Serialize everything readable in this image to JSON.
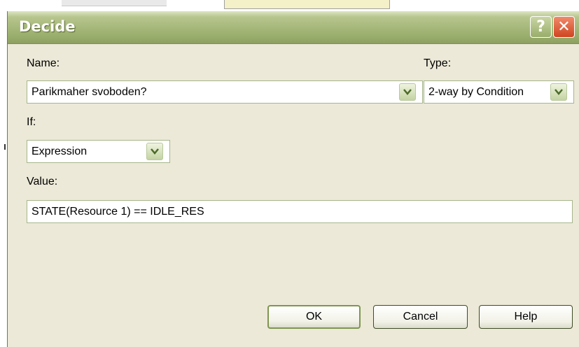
{
  "dialog": {
    "title": "Decide",
    "help_glyph": "?",
    "close_glyph": "✕"
  },
  "form": {
    "name_label": "Name:",
    "name_value": "Parikmaher svoboden?",
    "type_label": "Type:",
    "type_value": "2-way by Condition",
    "if_label": "If:",
    "if_value": "Expression",
    "value_label": "Value:",
    "value_value": "STATE(Resource 1) == IDLE_RES"
  },
  "buttons": {
    "ok": "OK",
    "cancel": "Cancel",
    "help": "Help"
  },
  "icons": {
    "help": "help-question-icon",
    "close": "close-x-icon",
    "dropdown": "chevron-down-icon"
  },
  "colors": {
    "titlebar": "#a7b97b",
    "dialog_bg": "#ece9d8",
    "close_button": "#cf4520",
    "field_border": "#a5b68b"
  }
}
